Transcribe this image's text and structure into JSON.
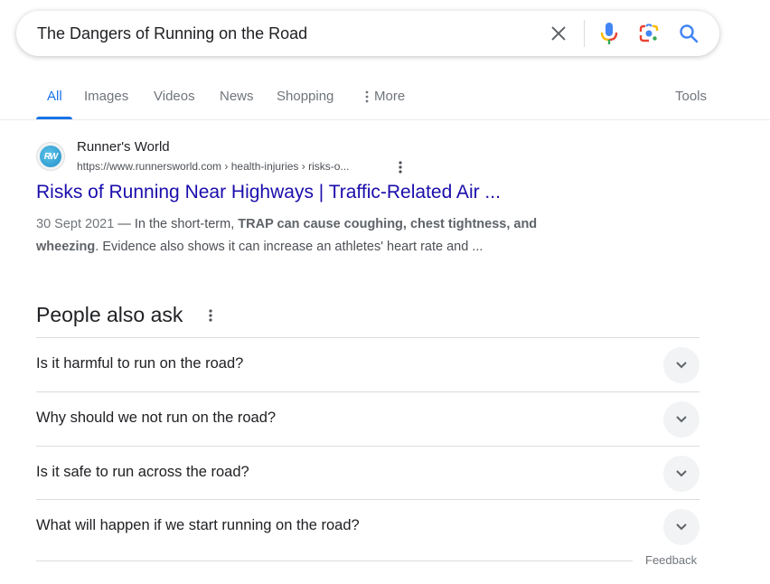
{
  "search": {
    "query": "The Dangers of Running on the Road",
    "icons": [
      "clear-icon",
      "microphone-icon",
      "google-lens-icon",
      "search-icon"
    ]
  },
  "tabs": {
    "items": [
      {
        "label": "All",
        "active": true
      },
      {
        "label": "Images",
        "active": false
      },
      {
        "label": "Videos",
        "active": false
      },
      {
        "label": "News",
        "active": false
      },
      {
        "label": "Shopping",
        "active": false
      },
      {
        "label": "More",
        "active": false
      }
    ],
    "tools_label": "Tools"
  },
  "result": {
    "favicon_text": "RW",
    "site_name": "Runner's World",
    "url": "https://www.runnersworld.com › health-injuries › risks-o...",
    "title": "Risks of Running Near Highways | Traffic-Related Air ...",
    "date": "30 Sept 2021",
    "snippet_pre": " — In the short-term, ",
    "snippet_bold": "TRAP can cause coughing, chest tightness, and wheezing",
    "snippet_post": ". Evidence also shows it can increase an athletes' heart rate and ..."
  },
  "paa": {
    "title": "People also ask",
    "questions": [
      "Is it harmful to run on the road?",
      "Why should we not run on the road?",
      "Is it safe to run across the road?",
      "What will happen if we start running on the road?"
    ],
    "feedback_label": "Feedback"
  },
  "colors": {
    "accent": "#1a73e8",
    "link": "#1a0dab"
  }
}
